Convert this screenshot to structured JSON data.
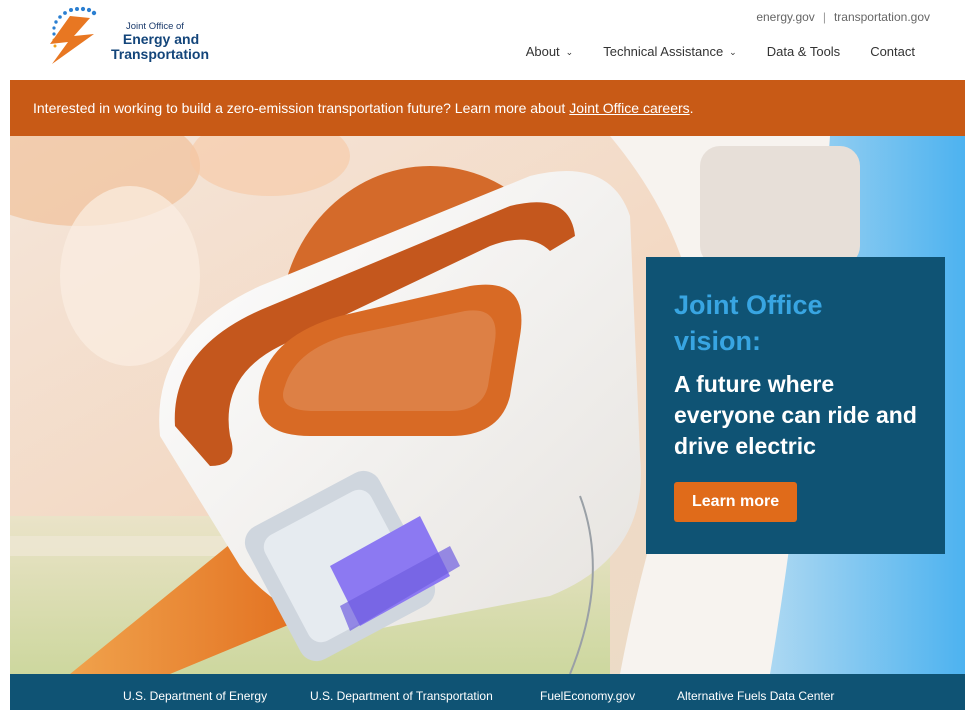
{
  "brand": {
    "logo_small": "Joint Office of",
    "logo_line1": "Energy and",
    "logo_line2": "Transportation"
  },
  "utility_links": [
    "energy.gov",
    "transportation.gov"
  ],
  "nav": [
    {
      "label": "About",
      "has_dropdown": true
    },
    {
      "label": "Technical Assistance",
      "has_dropdown": true
    },
    {
      "label": "Data & Tools",
      "has_dropdown": false
    },
    {
      "label": "Contact",
      "has_dropdown": false
    }
  ],
  "announcement": {
    "text": "Interested in working to build a zero-emission transportation future? Learn more about",
    "link": "Joint Office careers",
    "suffix": "."
  },
  "hero": {
    "accent_heading": "Joint Office vision:",
    "main_heading": "A future where everyone can ride and drive electric",
    "cta": "Learn more"
  },
  "footer_links": [
    "U.S. Department of Energy",
    "U.S. Department of Transportation",
    "FuelEconomy.gov",
    "Alternative Fuels Data Center"
  ],
  "colors": {
    "announcement_bg": "#c85a16",
    "panel_bg": "#0f5374",
    "accent_blue": "#38a5e2",
    "cta_orange": "#e06b1a"
  }
}
